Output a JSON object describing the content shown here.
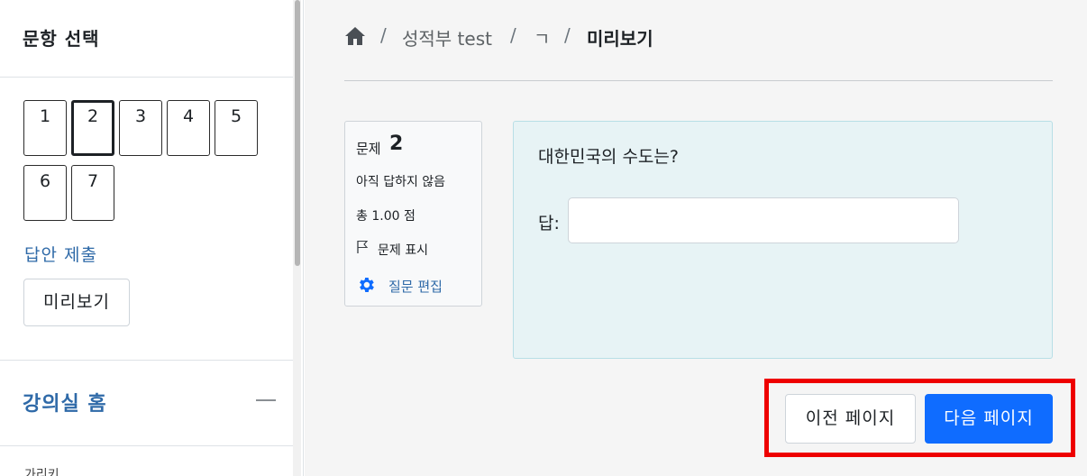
{
  "sidebar": {
    "title": "문항 선택",
    "questions": [
      {
        "label": "1",
        "current": false
      },
      {
        "label": "2",
        "current": true
      },
      {
        "label": "3",
        "current": false
      },
      {
        "label": "4",
        "current": false
      },
      {
        "label": "5",
        "current": false
      },
      {
        "label": "6",
        "current": false
      },
      {
        "label": "7",
        "current": false
      }
    ],
    "submit_link": "답안 제출",
    "preview_button": "미리보기",
    "course_home": "강의실 홈",
    "collapse_icon": "minus-icon",
    "cutoff_text": "가리키"
  },
  "breadcrumb": {
    "home_icon": "home-icon",
    "separator": "/",
    "items": [
      "성적부 test",
      "ㄱ",
      "미리보기"
    ]
  },
  "question": {
    "number_label": "문제",
    "number": "2",
    "status": "아직 답하지 않음",
    "points": "총 1.00 점",
    "flag_label": "문제 표시",
    "flag_icon": "flag-icon",
    "edit_label": "질문 편집",
    "edit_icon": "gear-icon",
    "text": "대한민국의 수도는?",
    "answer_label": "답:",
    "answer_value": ""
  },
  "navigation": {
    "prev_label": "이전 페이지",
    "next_label": "다음 페이지"
  },
  "colors": {
    "link": "#2f6aa8",
    "primary_button": "#0f6cff",
    "question_bg": "#e7f3f5",
    "highlight": "#ee0000"
  }
}
